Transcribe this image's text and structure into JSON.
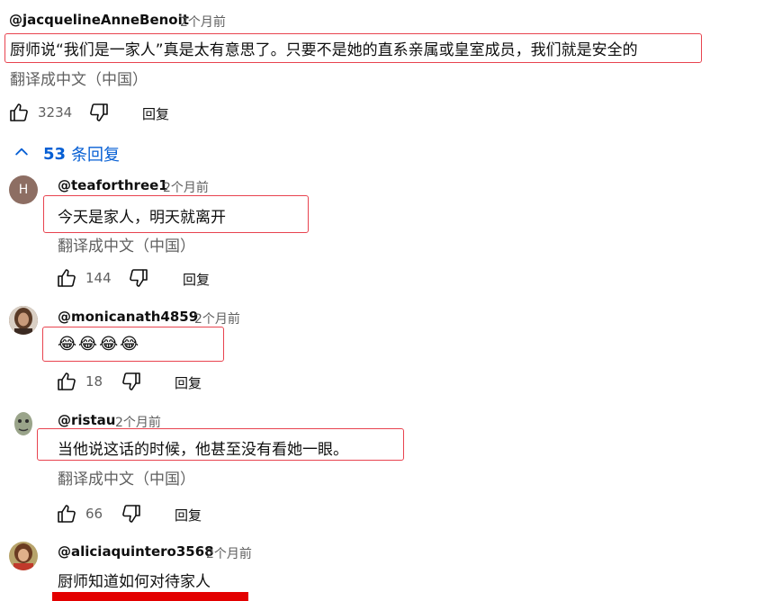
{
  "top_comment": {
    "author": "@jacquelineAnneBenoit",
    "time": "2个月前",
    "text": "厨师说“我们是一家人”真是太有意思了。只要不是她的直系亲属或皇室成员，我们就是安全的",
    "translate": "翻译成中文（中国）",
    "likes": "3234",
    "reply_label": "回复"
  },
  "replies_toggle": {
    "count": "53",
    "label": "条回复"
  },
  "replies": [
    {
      "author": "@teaforthree1",
      "avatar_letter": "H",
      "time": "2个月前",
      "text": "今天是家人，明天就离开",
      "translate": "翻译成中文（中国）",
      "likes": "144",
      "reply_label": "回复"
    },
    {
      "author": "@monicanath4859",
      "time": "2个月前",
      "text": "😂😂😂😂",
      "likes": "18",
      "reply_label": "回复"
    },
    {
      "author": "@ristau",
      "time": "2个月前",
      "text": "当他说这话的时候，他甚至没有看她一眼。",
      "translate": "翻译成中文（中国）",
      "likes": "66",
      "reply_label": "回复"
    },
    {
      "author": "@aliciaquintero3568",
      "time": "2个月前",
      "text": "厨师知道如何对待家人"
    }
  ],
  "colors": {
    "highlight_border": "#e8434f",
    "link_blue": "#065fd4",
    "avatar_h": "#8d6e63",
    "bottom_bar": "#e30000"
  },
  "icons": {
    "like": "thumbs-up-icon",
    "dislike": "thumbs-down-icon",
    "collapse": "chevron-up-icon"
  }
}
